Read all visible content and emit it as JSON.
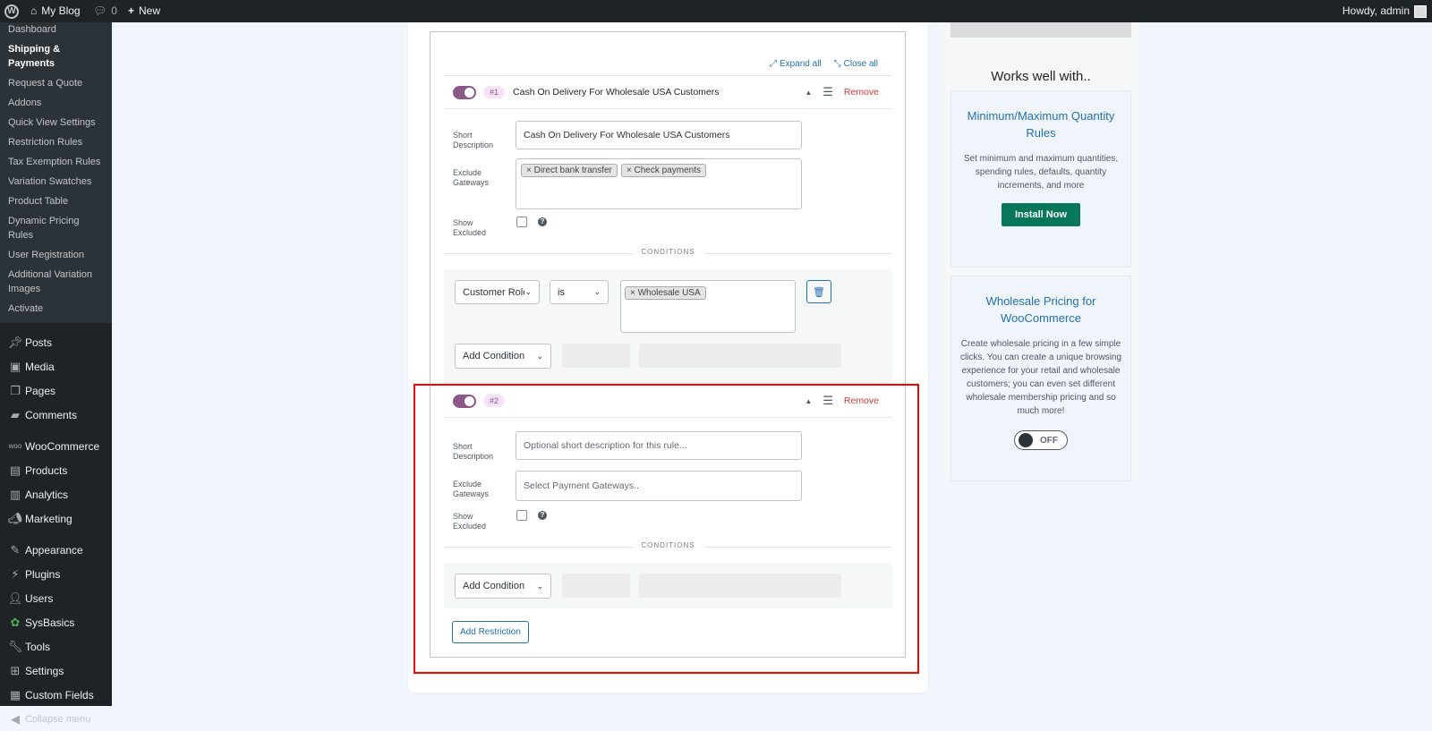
{
  "adminbar": {
    "site_name": "My Blog",
    "comments_count": "0",
    "new_label": "New",
    "howdy": "Howdy, admin"
  },
  "sidebar": {
    "submenu": [
      {
        "label": "Dashboard"
      },
      {
        "label": "Shipping & Payments"
      },
      {
        "label": "Request a Quote"
      },
      {
        "label": "Addons"
      },
      {
        "label": "Quick View Settings"
      },
      {
        "label": "Restriction Rules"
      },
      {
        "label": "Tax Exemption Rules"
      },
      {
        "label": "Variation Swatches"
      },
      {
        "label": "Product Table"
      },
      {
        "label": "Dynamic Pricing Rules"
      },
      {
        "label": "User Registration"
      },
      {
        "label": "Additional Variation Images"
      },
      {
        "label": "Activate"
      }
    ],
    "menu": [
      {
        "label": "Posts",
        "icon": "pin-icon"
      },
      {
        "label": "Media",
        "icon": "media-icon"
      },
      {
        "label": "Pages",
        "icon": "pages-icon"
      },
      {
        "label": "Comments",
        "icon": "comment-icon"
      },
      {
        "label": "WooCommerce",
        "icon": "woo-icon"
      },
      {
        "label": "Products",
        "icon": "archive-icon"
      },
      {
        "label": "Analytics",
        "icon": "chart-icon"
      },
      {
        "label": "Marketing",
        "icon": "megaphone-icon"
      },
      {
        "label": "Appearance",
        "icon": "brush-icon"
      },
      {
        "label": "Plugins",
        "icon": "plugin-icon"
      },
      {
        "label": "Users",
        "icon": "user-icon"
      },
      {
        "label": "SysBasics",
        "icon": "sysbasics-icon"
      },
      {
        "label": "Tools",
        "icon": "wrench-icon"
      },
      {
        "label": "Settings",
        "icon": "settings-icon"
      },
      {
        "label": "Custom Fields",
        "icon": "grid-icon"
      }
    ],
    "collapse_label": "Collapse menu"
  },
  "main": {
    "expand_all": "Expand all",
    "close_all": "Close all",
    "rules": [
      {
        "number": "#1",
        "title": "Cash On Delivery For Wholesale USA Customers",
        "remove_label": "Remove",
        "short_desc_label": "Short Description",
        "short_desc_value": "Cash On Delivery For Wholesale USA Customers",
        "exclude_label": "Exclude Gateways",
        "gateways": [
          "× Direct bank transfer",
          "× Check payments"
        ],
        "show_excluded_label": "Show Excluded",
        "conditions_label": "CONDITIONS",
        "condition": {
          "field": "Customer Role",
          "operator": "is",
          "values": [
            "× Wholesale USA"
          ]
        },
        "add_condition": "Add Condition"
      },
      {
        "number": "#2",
        "title": "",
        "remove_label": "Remove",
        "short_desc_label": "Short Description",
        "short_desc_placeholder": "Optional short description for this rule...",
        "exclude_label": "Exclude Gateways",
        "gateways_placeholder": "Select Payment Gateways..",
        "show_excluded_label": "Show Excluded",
        "conditions_label": "CONDITIONS",
        "add_condition": "Add Condition"
      }
    ],
    "add_restriction": "Add Restriction"
  },
  "right": {
    "works_title": "Works well with..",
    "promos": [
      {
        "title": "Minimum/Maximum Quantity Rules",
        "desc": "Set minimum and maximum quantities, spending rules, defaults, quantity increments, and more",
        "button": "Install Now"
      },
      {
        "title": "Wholesale Pricing for WooCommerce",
        "desc": "Create wholesale pricing in a few simple clicks. You can create a unique browsing experience for your retail and wholesale customers; you can even set different wholesale membership pricing and so much more!",
        "toggle": "OFF"
      }
    ]
  },
  "colors": {
    "admin_bar": "#1d2327",
    "accent": "#2271b1",
    "toggle_on": "#8c5888",
    "remove": "#d63638",
    "install": "#07775a",
    "highlight": "#ff0000"
  }
}
